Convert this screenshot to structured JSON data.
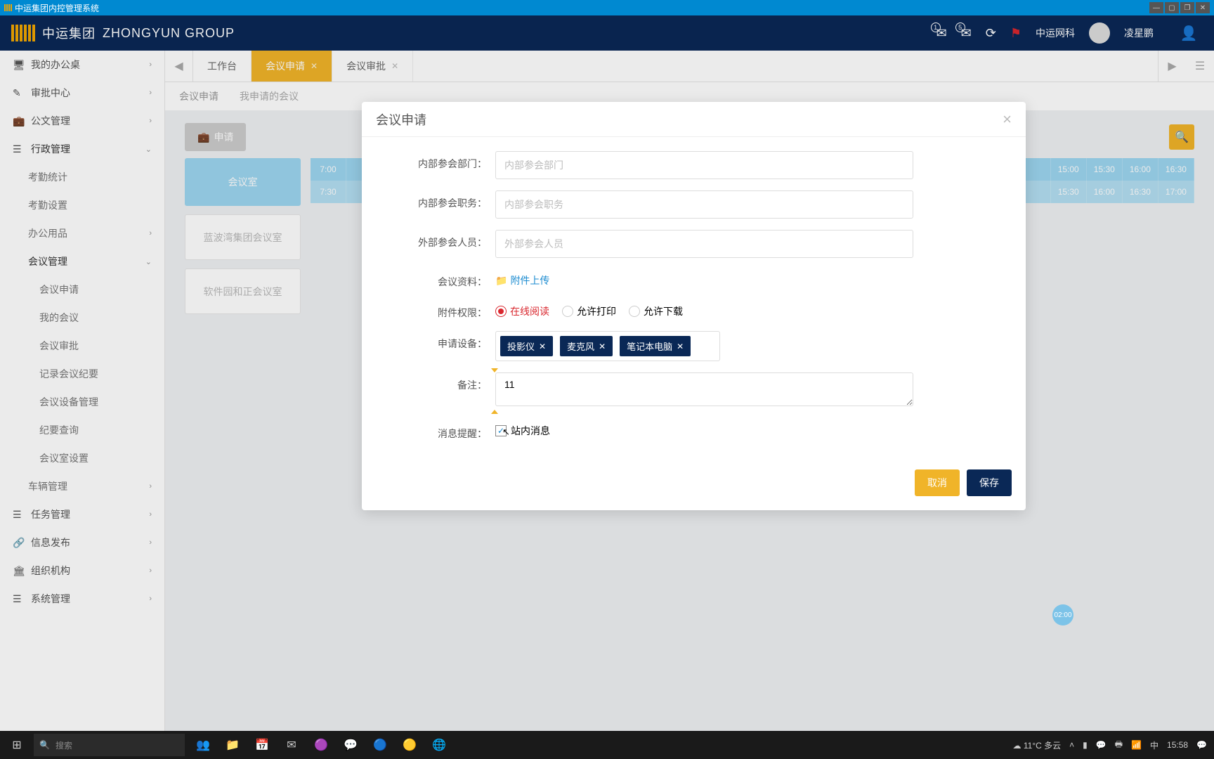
{
  "titlebar": {
    "app_name": "中运集团内控管理系统"
  },
  "header": {
    "brand_cn": "中运集团",
    "brand_en": "ZHONGYUN GROUP",
    "badge1": "1",
    "badge2": "5",
    "company": "中运网科",
    "user": "凌星鹏"
  },
  "sidebar": {
    "my_desk": "我的办公桌",
    "approval_center": "审批中心",
    "doc_mgmt": "公文管理",
    "admin_mgmt": "行政管理",
    "attendance_stat": "考勤统计",
    "attendance_set": "考勤设置",
    "office_supply": "办公用品",
    "meeting_mgmt": "会议管理",
    "meeting_apply": "会议申请",
    "my_meeting": "我的会议",
    "meeting_approve": "会议审批",
    "meeting_record": "记录会议纪要",
    "meeting_device": "会议设备管理",
    "record_query": "纪要查询",
    "room_set": "会议室设置",
    "vehicle_mgmt": "车辆管理",
    "task_mgmt": "任务管理",
    "info_pub": "信息发布",
    "org": "组织机构",
    "sys_mgmt": "系统管理"
  },
  "tabs": {
    "workbench": "工作台",
    "meeting_apply": "会议申请",
    "meeting_approve": "会议审批"
  },
  "subtabs": {
    "apply": "会议申请",
    "mine": "我申请的会议"
  },
  "toolbar": {
    "apply_btn": "申请"
  },
  "schedule": {
    "head": "会议室",
    "room1": "蓝波湾集团会议室",
    "room2": "软件园和正会议室",
    "t1_start": "7:00",
    "t1_end": "7:30",
    "t_1500": "15:00",
    "t_1530": "15:30",
    "t_1600": "16:00",
    "t_1630": "16:30",
    "t_1700": "17:00"
  },
  "modal": {
    "title": "会议申请",
    "dept_label": "内部参会部门：",
    "dept_ph": "内部参会部门",
    "duty_label": "内部参会职务：",
    "duty_ph": "内部参会职务",
    "ext_label": "外部参会人员：",
    "ext_ph": "外部参会人员",
    "material_label": "会议资料：",
    "attach_text": "附件上传",
    "perm_label": "附件权限：",
    "perm_online": "在线阅读",
    "perm_print": "允许打印",
    "perm_download": "允许下载",
    "device_label": "申请设备：",
    "tags": [
      "投影仪",
      "麦克风",
      "笔记本电脑"
    ],
    "remark_label": "备注：",
    "remark_value": "11",
    "notice_label": "消息提醒：",
    "notice_check": "站内消息",
    "cancel": "取消",
    "save": "保存"
  },
  "float": {
    "badge": "02:00"
  },
  "taskbar": {
    "search_ph": "搜索",
    "weather": "11°C 多云",
    "ime": "中",
    "time": "15:58"
  }
}
